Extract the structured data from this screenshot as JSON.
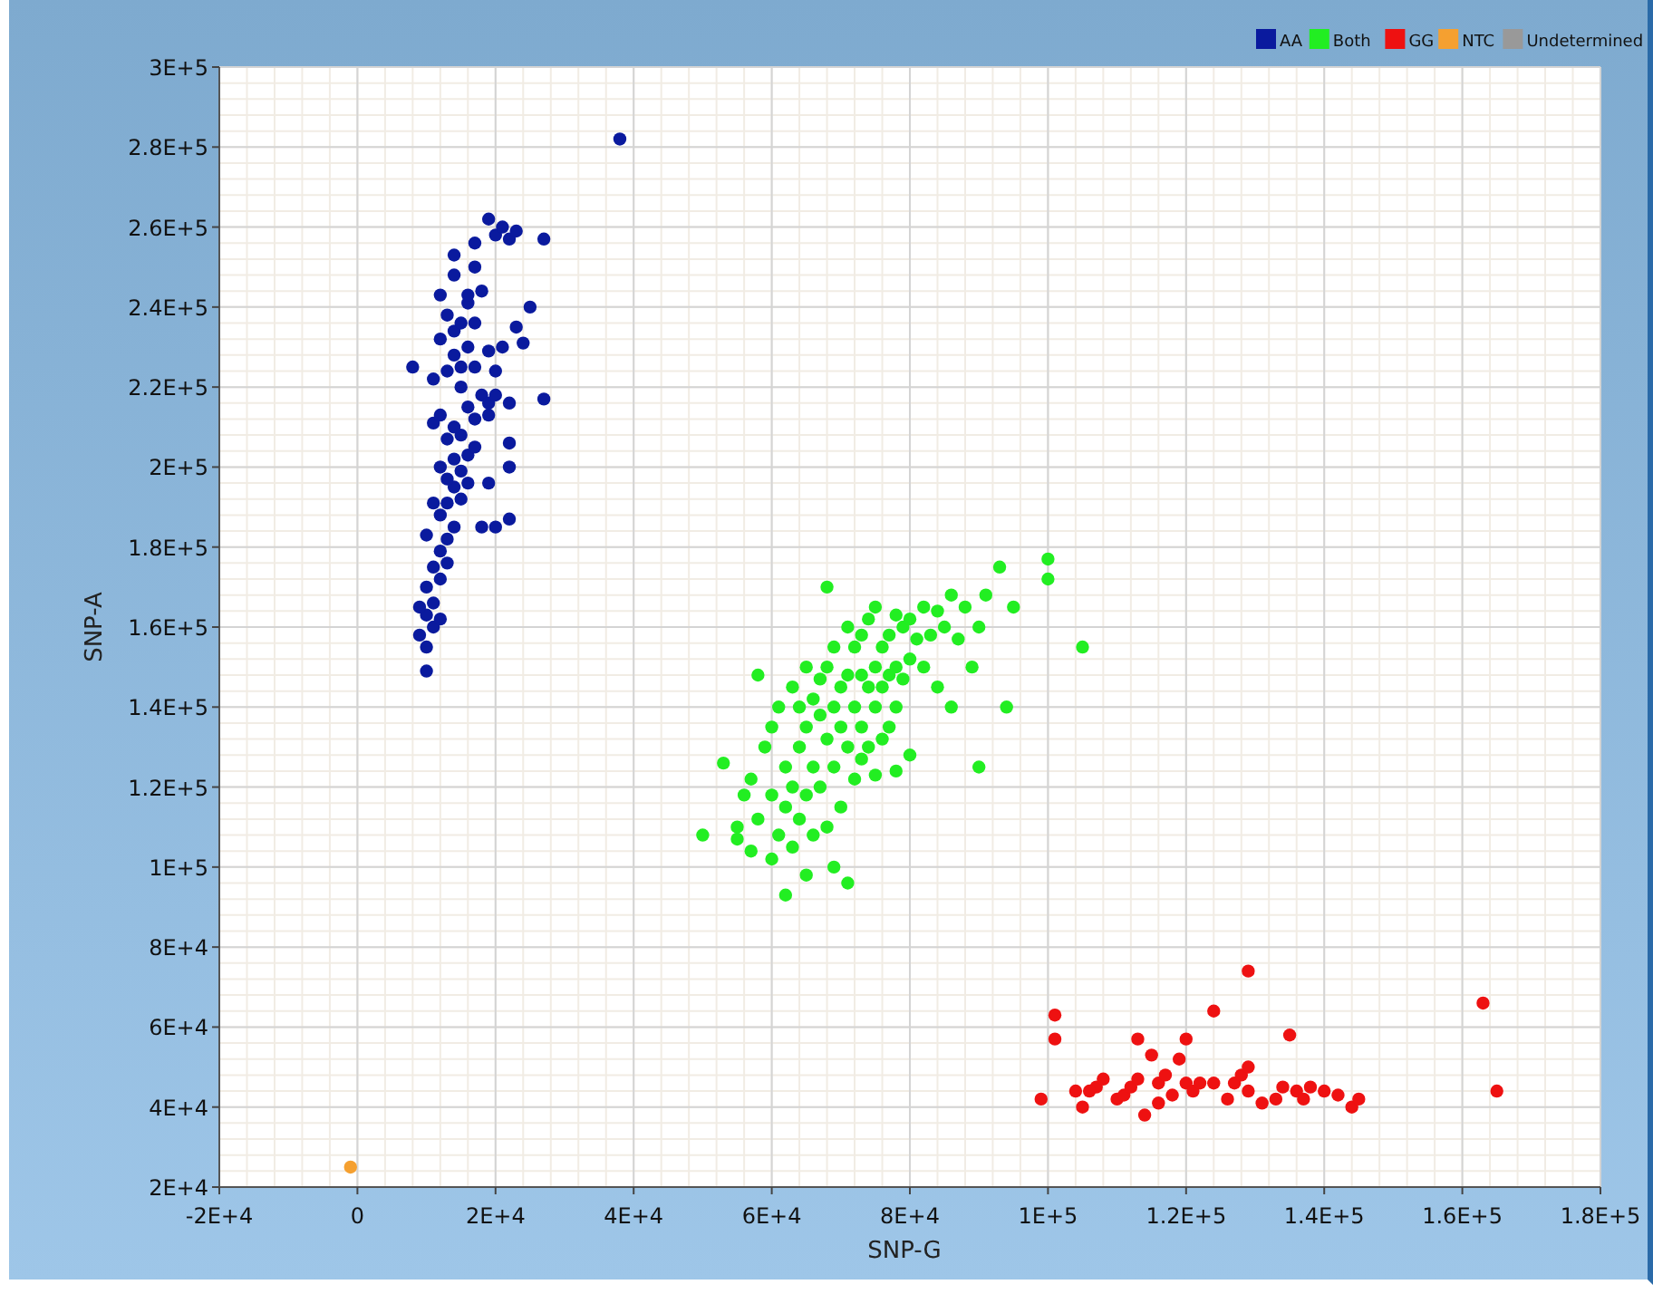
{
  "chart_data": {
    "type": "scatter",
    "grid": true,
    "legend": true,
    "xlabel": "SNP-G",
    "ylabel": "SNP-A",
    "xlim": [
      -20000,
      180000
    ],
    "ylim": [
      20000,
      300000
    ],
    "xticks": [
      {
        "value": -20000,
        "label": "-2E+4"
      },
      {
        "value": 0,
        "label": "0"
      },
      {
        "value": 20000,
        "label": "2E+4"
      },
      {
        "value": 40000,
        "label": "4E+4"
      },
      {
        "value": 60000,
        "label": "6E+4"
      },
      {
        "value": 80000,
        "label": "8E+4"
      },
      {
        "value": 100000,
        "label": "1E+5"
      },
      {
        "value": 120000,
        "label": "1.2E+5"
      },
      {
        "value": 140000,
        "label": "1.4E+5"
      },
      {
        "value": 160000,
        "label": "1.6E+5"
      },
      {
        "value": 180000,
        "label": "1.8E+5"
      }
    ],
    "yticks": [
      {
        "value": 20000,
        "label": "2E+4"
      },
      {
        "value": 40000,
        "label": "4E+4"
      },
      {
        "value": 60000,
        "label": "6E+4"
      },
      {
        "value": 80000,
        "label": "8E+4"
      },
      {
        "value": 100000,
        "label": "1E+5"
      },
      {
        "value": 120000,
        "label": "1.2E+5"
      },
      {
        "value": 140000,
        "label": "1.4E+5"
      },
      {
        "value": 160000,
        "label": "1.6E+5"
      },
      {
        "value": 180000,
        "label": "1.8E+5"
      },
      {
        "value": 200000,
        "label": "2E+5"
      },
      {
        "value": 220000,
        "label": "2.2E+5"
      },
      {
        "value": 240000,
        "label": "2.4E+5"
      },
      {
        "value": 260000,
        "label": "2.6E+5"
      },
      {
        "value": 280000,
        "label": "2.8E+5"
      },
      {
        "value": 300000,
        "label": "3E+5"
      }
    ],
    "series": [
      {
        "name": "AA",
        "color": "#0a1a9e",
        "x": [
          10000,
          10000,
          9000,
          11000,
          10000,
          9000,
          11000,
          12000,
          10000,
          12000,
          11000,
          13000,
          12000,
          10000,
          13000,
          14000,
          12000,
          13000,
          11000,
          15000,
          14000,
          13000,
          16000,
          15000,
          12000,
          14000,
          16000,
          17000,
          13000,
          15000,
          14000,
          11000,
          12000,
          17000,
          16000,
          19000,
          22000,
          18000,
          19000,
          27000,
          11000,
          13000,
          15000,
          17000,
          20000,
          8000,
          14000,
          16000,
          19000,
          21000,
          24000,
          12000,
          14000,
          15000,
          13000,
          17000,
          16000,
          23000,
          25000,
          12000,
          16000,
          18000,
          14000,
          17000,
          14000,
          17000,
          20000,
          22000,
          23000,
          27000,
          19000,
          21000,
          18000,
          20000,
          22000,
          19000,
          22000,
          20000,
          38000,
          22000,
          15000
        ],
        "values": [
          149000,
          155000,
          158000,
          160000,
          163000,
          165000,
          166000,
          162000,
          170000,
          172000,
          175000,
          176000,
          179000,
          183000,
          182000,
          185000,
          188000,
          191000,
          191000,
          192000,
          195000,
          197000,
          196000,
          199000,
          200000,
          202000,
          203000,
          205000,
          207000,
          208000,
          210000,
          211000,
          213000,
          212000,
          215000,
          213000,
          216000,
          218000,
          216000,
          217000,
          222000,
          224000,
          225000,
          225000,
          224000,
          225000,
          228000,
          230000,
          229000,
          230000,
          231000,
          232000,
          234000,
          236000,
          238000,
          236000,
          241000,
          235000,
          240000,
          243000,
          243000,
          244000,
          248000,
          250000,
          253000,
          256000,
          258000,
          257000,
          259000,
          257000,
          262000,
          260000,
          185000,
          185000,
          187000,
          196000,
          206000,
          218000,
          282000,
          200000,
          220000
        ]
      },
      {
        "name": "Both",
        "color": "#22ee22",
        "x": [
          50000,
          53000,
          55000,
          55000,
          56000,
          57000,
          57000,
          58000,
          58000,
          59000,
          60000,
          60000,
          60000,
          61000,
          61000,
          62000,
          62000,
          62000,
          63000,
          63000,
          63000,
          64000,
          64000,
          64000,
          65000,
          65000,
          65000,
          65000,
          66000,
          66000,
          66000,
          67000,
          67000,
          67000,
          68000,
          68000,
          68000,
          68000,
          69000,
          69000,
          69000,
          69000,
          70000,
          70000,
          70000,
          71000,
          71000,
          71000,
          71000,
          72000,
          72000,
          72000,
          73000,
          73000,
          73000,
          73000,
          74000,
          74000,
          74000,
          75000,
          75000,
          75000,
          75000,
          76000,
          76000,
          76000,
          77000,
          77000,
          77000,
          78000,
          78000,
          78000,
          79000,
          79000,
          80000,
          80000,
          80000,
          81000,
          82000,
          82000,
          83000,
          84000,
          85000,
          86000,
          87000,
          88000,
          89000,
          90000,
          90000,
          91000,
          93000,
          94000,
          95000,
          100000,
          100000,
          105000,
          78000,
          84000,
          86000
        ],
        "values": [
          108000,
          126000,
          110000,
          107000,
          118000,
          122000,
          104000,
          148000,
          112000,
          130000,
          135000,
          118000,
          102000,
          140000,
          108000,
          93000,
          125000,
          115000,
          145000,
          120000,
          105000,
          140000,
          130000,
          112000,
          150000,
          135000,
          118000,
          98000,
          142000,
          125000,
          108000,
          147000,
          138000,
          120000,
          170000,
          150000,
          132000,
          110000,
          155000,
          140000,
          125000,
          100000,
          145000,
          135000,
          115000,
          160000,
          148000,
          130000,
          96000,
          155000,
          140000,
          122000,
          158000,
          148000,
          135000,
          127000,
          162000,
          145000,
          130000,
          165000,
          150000,
          140000,
          123000,
          155000,
          145000,
          132000,
          158000,
          148000,
          135000,
          163000,
          150000,
          140000,
          160000,
          147000,
          162000,
          152000,
          128000,
          157000,
          165000,
          150000,
          158000,
          164000,
          160000,
          168000,
          157000,
          165000,
          150000,
          160000,
          125000,
          168000,
          175000,
          140000,
          165000,
          177000,
          172000,
          155000,
          124000,
          145000,
          140000
        ]
      },
      {
        "name": "GG",
        "color": "#ee1111",
        "x": [
          99000,
          101000,
          101000,
          104000,
          105000,
          107000,
          108000,
          110000,
          111000,
          112000,
          113000,
          113000,
          114000,
          115000,
          116000,
          116000,
          117000,
          118000,
          119000,
          120000,
          120000,
          121000,
          122000,
          124000,
          124000,
          126000,
          127000,
          128000,
          129000,
          129000,
          129000,
          131000,
          133000,
          134000,
          135000,
          136000,
          137000,
          138000,
          140000,
          142000,
          144000,
          145000,
          163000,
          165000,
          106000
        ],
        "values": [
          42000,
          63000,
          57000,
          44000,
          40000,
          45000,
          47000,
          42000,
          43000,
          45000,
          57000,
          47000,
          38000,
          53000,
          46000,
          41000,
          48000,
          43000,
          52000,
          57000,
          46000,
          44000,
          46000,
          64000,
          46000,
          42000,
          46000,
          48000,
          50000,
          74000,
          44000,
          41000,
          42000,
          45000,
          58000,
          44000,
          42000,
          45000,
          44000,
          43000,
          40000,
          42000,
          66000,
          44000,
          44000
        ]
      },
      {
        "name": "NTC",
        "color": "#f5a030",
        "x": [
          -1000
        ],
        "values": [
          25000
        ]
      },
      {
        "name": "Undetermined",
        "color": "#999999"
      }
    ]
  }
}
